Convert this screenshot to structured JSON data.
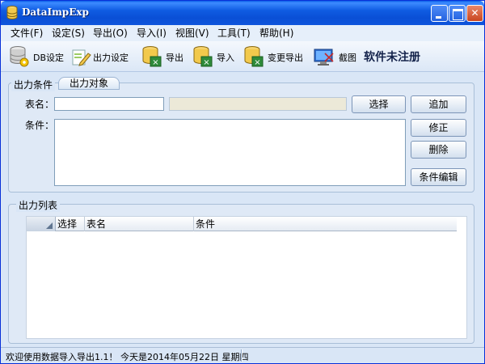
{
  "window": {
    "title": "DataImpExp"
  },
  "menu": [
    {
      "label": "文件(F)"
    },
    {
      "label": "设定(S)"
    },
    {
      "label": "导出(O)"
    },
    {
      "label": "导入(I)"
    },
    {
      "label": "视图(V)"
    },
    {
      "label": "工具(T)"
    },
    {
      "label": "帮助(H)"
    }
  ],
  "toolbar": {
    "db_settings": "DB设定",
    "output_settings": "出力设定",
    "export": "导出",
    "import": "导入",
    "change_export": "变更导出",
    "screenshot": "截图",
    "unregistered": "软件未注册"
  },
  "condition_group": {
    "title": "出力条件",
    "tab_label": "出力对象",
    "table_name_label": "表名：",
    "condition_label": "条件：",
    "table_name_value": "",
    "condition_value": "",
    "select_button": "选择",
    "add_button": "追加",
    "modify_button": "修正",
    "delete_button": "删除",
    "edit_condition_button": "条件编辑"
  },
  "list_group": {
    "title": "出力列表",
    "columns": [
      "选择",
      "表名",
      "条件"
    ]
  },
  "status": {
    "text": "欢迎使用数据导入导出1.1！ 今天是2014年05月22日   星期四"
  },
  "colors": {
    "titlebar": "#0a4fd6",
    "window_bg": "#d9e6f6",
    "group_border": "#a9bfd8"
  }
}
